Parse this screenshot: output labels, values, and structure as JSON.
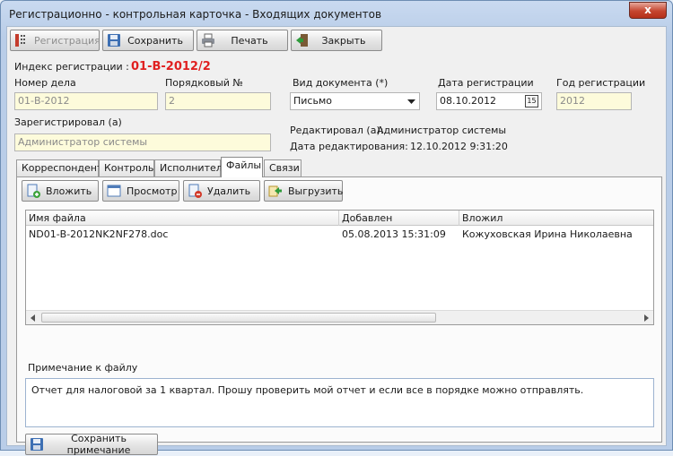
{
  "window": {
    "title": "Регистрационно - контрольная карточка - Входящих документов",
    "close_label": "x"
  },
  "toolbar": {
    "registration_label": "Регистрация",
    "save_label": "Сохранить",
    "print_label": "Печать",
    "close_label": "Закрыть"
  },
  "form": {
    "reg_index_label": "Индекс регистрации :",
    "reg_index_value": "01-В-2012/2",
    "case_number_label": "Номер дела",
    "case_number_value": "01-В-2012",
    "ordinal_label": "Порядковый №",
    "ordinal_value": "2",
    "doc_type_label": "Вид документа (*)",
    "doc_type_value": "Письмо",
    "reg_date_label": "Дата регистрации",
    "reg_date_value": "08.10.2012",
    "calendar_glyph": "15",
    "reg_year_label": "Год регистрации",
    "reg_year_value": "2012",
    "registered_by_label": "Зарегистрировал (а)",
    "registered_by_value": "Администратор системы",
    "edited_by_label": "Редактировал (а):",
    "edited_by_value": "Администратор системы",
    "edit_date_label": "Дата редактирования:",
    "edit_date_value": "12.10.2012 9:31:20"
  },
  "tabs": [
    {
      "label": "Корреспондент"
    },
    {
      "label": "Контроль"
    },
    {
      "label": "Исполнители"
    },
    {
      "label": "Файлы"
    },
    {
      "label": "Связи"
    }
  ],
  "files_panel": {
    "upload_label": "Вложить",
    "view_label": "Просмотр",
    "delete_label": "Удалить",
    "export_label": "Выгрузить",
    "columns": [
      "Имя файла",
      "Добавлен",
      "Вложил"
    ],
    "rows": [
      [
        "ND01-В-2012NK2NF278.doc",
        "05.08.2013 15:31:09",
        "Кожуховская Ирина Николаевна"
      ]
    ],
    "note_label": "Примечание к файлу",
    "note_text": "Отчет для налоговой за 1 квартал. Прошу проверить мой отчет и если все в порядке можно отправлять.",
    "save_note_label": "Сохранить примечание"
  },
  "colors": {
    "reg_index": "#e02020",
    "readonly_field": "#fdfbdb",
    "close_button": "#c5452f"
  }
}
